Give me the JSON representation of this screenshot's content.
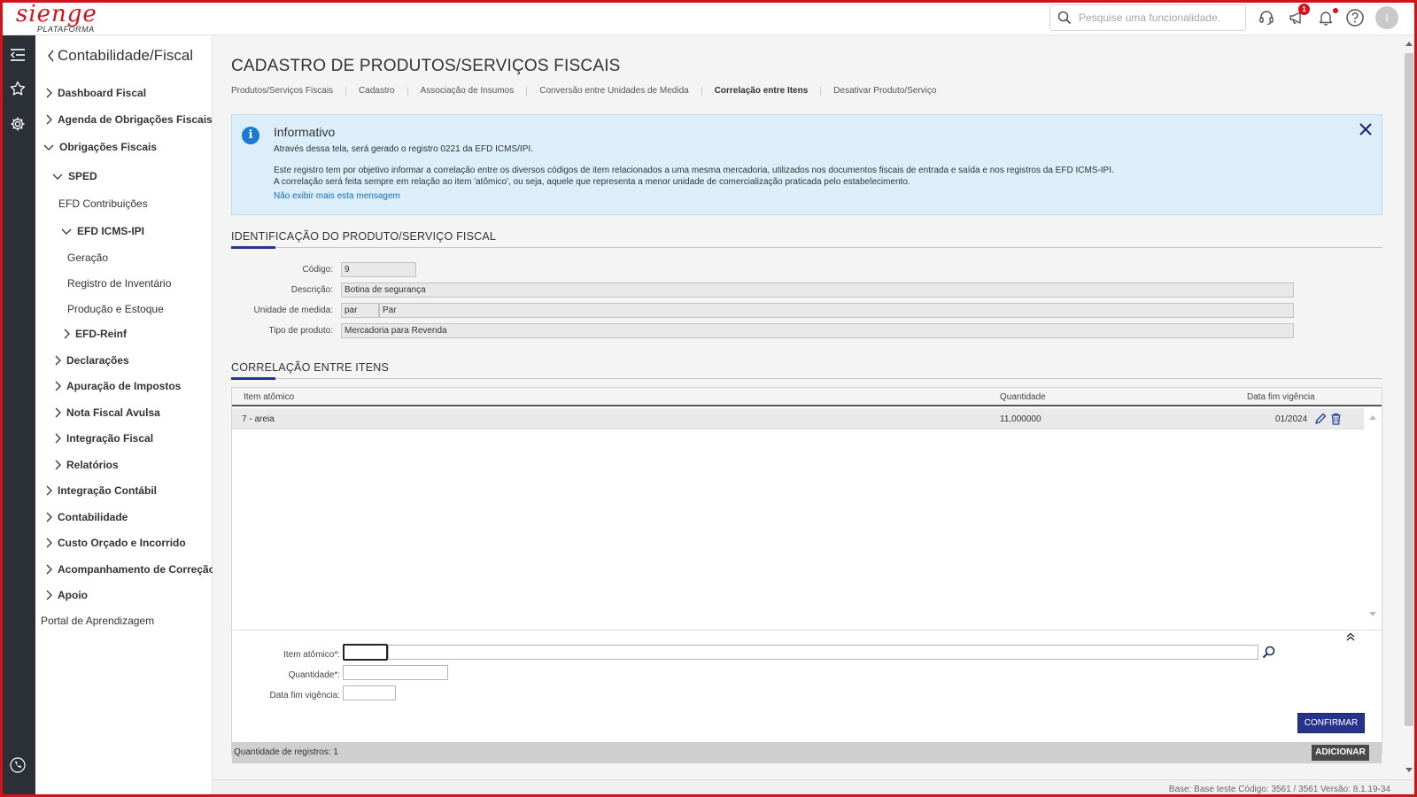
{
  "brand": {
    "logo_text": "sienge",
    "logo_sub": "PLATAFORMA"
  },
  "header": {
    "search_placeholder": "Pesquise uma funcionalidade.",
    "notification_count": "1",
    "avatar_letter": "I"
  },
  "sidebar": {
    "title": "Contabilidade/Fiscal",
    "items": [
      {
        "label": "Dashboard Fiscal"
      },
      {
        "label": "Agenda de Obrigações Fiscais"
      },
      {
        "label": "Obrigações Fiscais"
      },
      {
        "label": "SPED"
      },
      {
        "label": "EFD Contribuições"
      },
      {
        "label": "EFD ICMS-IPI"
      },
      {
        "label": "Geração"
      },
      {
        "label": "Registro de Inventário"
      },
      {
        "label": "Produção e Estoque"
      },
      {
        "label": "EFD-Reinf"
      },
      {
        "label": "Declarações"
      },
      {
        "label": "Apuração de Impostos"
      },
      {
        "label": "Nota Fiscal Avulsa"
      },
      {
        "label": "Integração Fiscal"
      },
      {
        "label": "Relatórios"
      },
      {
        "label": "Integração Contábil"
      },
      {
        "label": "Contabilidade"
      },
      {
        "label": "Custo Orçado e Incorrido"
      },
      {
        "label": "Acompanhamento de Correção"
      },
      {
        "label": "Apoio"
      },
      {
        "label": "Portal de Aprendizagem"
      }
    ]
  },
  "page": {
    "title": "CADASTRO DE PRODUTOS/SERVIÇOS FISCAIS",
    "tabs": [
      "Produtos/Serviços Fiscais",
      "Cadastro",
      "Associação de Insumos",
      "Conversão entre Unidades de Medida",
      "Correlação entre Itens",
      "Desativar Produto/Serviço"
    ]
  },
  "info": {
    "title": "Informativo",
    "line1": "Através dessa tela, será gerado o registro 0221 da EFD ICMS/IPI.",
    "line2": "Este registro tem por objetivo informar a correlação entre os diversos códigos de item relacionados a uma mesma mercadoria, utilizados nos documentos fiscais de entrada e saída e nos registros da EFD ICMS-IPI.",
    "line3": "A correlação será feita sempre em relação ao item 'atômico', ou seja, aquele que representa a menor unidade de comercialização praticada pelo estabelecimento.",
    "dismiss_link": "Não exibir mais esta mensagem"
  },
  "identification": {
    "section_title": "IDENTIFICAÇÃO DO PRODUTO/SERVIÇO FISCAL",
    "codigo_label": "Código:",
    "codigo_value": "9",
    "descricao_label": "Descrição:",
    "descricao_value": "Botina de segurança",
    "unidade_label": "Unidade de medida:",
    "unidade_code": "par",
    "unidade_desc": "Par",
    "tipo_label": "Tipo de produto:",
    "tipo_value": "Mercadoria para Revenda"
  },
  "correlation": {
    "section_title": "CORRELAÇÃO ENTRE ITENS",
    "columns": [
      "Item atômico",
      "Quantidade",
      "Data fim vigência"
    ],
    "rows": [
      {
        "item": "7 - areia",
        "quantidade": "11,000000",
        "data_fim": "01/2024"
      }
    ],
    "form": {
      "item_label": "Item atômico*:",
      "quantidade_label": "Quantidade*:",
      "data_label": "Data fim vigência:",
      "confirm_label": "CONFIRMAR"
    },
    "records_count": "Quantidade de registros: 1",
    "add_label": "ADICIONAR"
  },
  "footer": {
    "text": "Base: Base teste  Código: 3561 / 3561  Versão: 8.1.19-34"
  },
  "colors": {
    "brand_red": "#d0121b",
    "primary_blue": "#27348b",
    "info_bg": "#dbeefa"
  }
}
